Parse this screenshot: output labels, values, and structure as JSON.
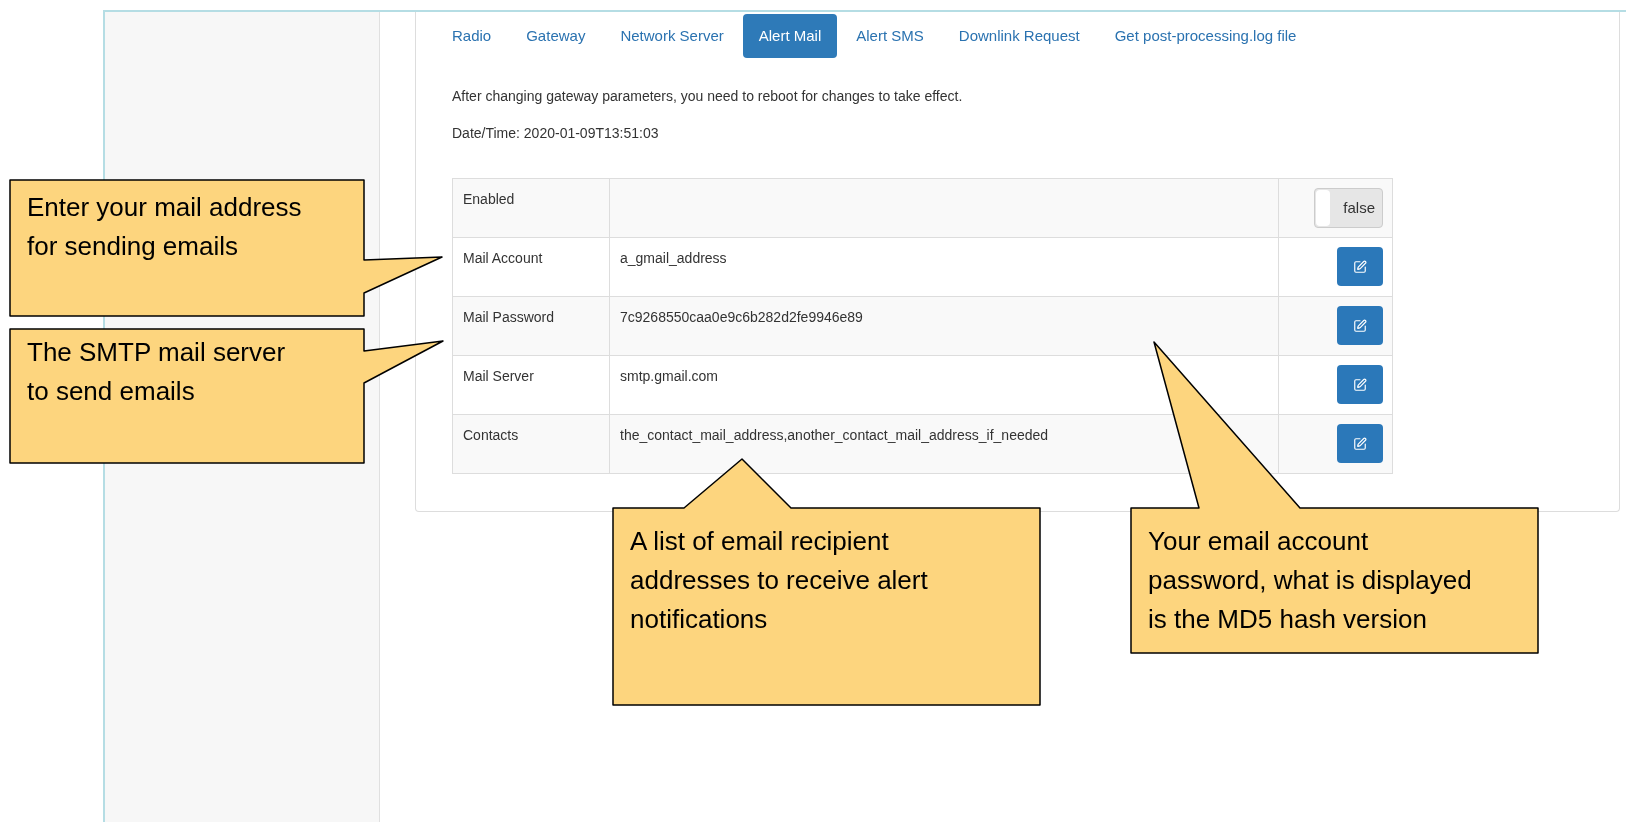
{
  "tabs": [
    {
      "label": "Radio",
      "selected": false
    },
    {
      "label": "Gateway",
      "selected": false
    },
    {
      "label": "Network Server",
      "selected": false
    },
    {
      "label": "Alert Mail",
      "selected": true
    },
    {
      "label": "Alert SMS",
      "selected": false
    },
    {
      "label": "Downlink Request",
      "selected": false
    },
    {
      "label": "Get post-processing.log file",
      "selected": false
    }
  ],
  "notice": "After changing gateway parameters, you need to reboot for changes to take effect.",
  "datetime": "Date/Time: 2020-01-09T13:51:03",
  "settings": [
    {
      "kind": "toggle",
      "label": "Enabled",
      "on": false,
      "toggle_label": "false"
    },
    {
      "kind": "edit",
      "label": "Mail Account",
      "value": "a_gmail_address"
    },
    {
      "kind": "edit",
      "label": "Mail Password",
      "value": "7c9268550caa0e9c6b282d2fe9946e89"
    },
    {
      "kind": "edit",
      "label": "Mail Server",
      "value": "smtp.gmail.com"
    },
    {
      "kind": "edit",
      "label": "Contacts",
      "value": "the_contact_mail_address,another_contact_mail_address_if_needed"
    }
  ],
  "callouts": [
    {
      "text": "Enter your mail address for sending emails"
    },
    {
      "text": "The SMTP mail server to send emails"
    },
    {
      "text": "A list of email recipient addresses to receive alert notifications"
    },
    {
      "text": "Your email account password, what is displayed is the MD5 hash version"
    }
  ]
}
